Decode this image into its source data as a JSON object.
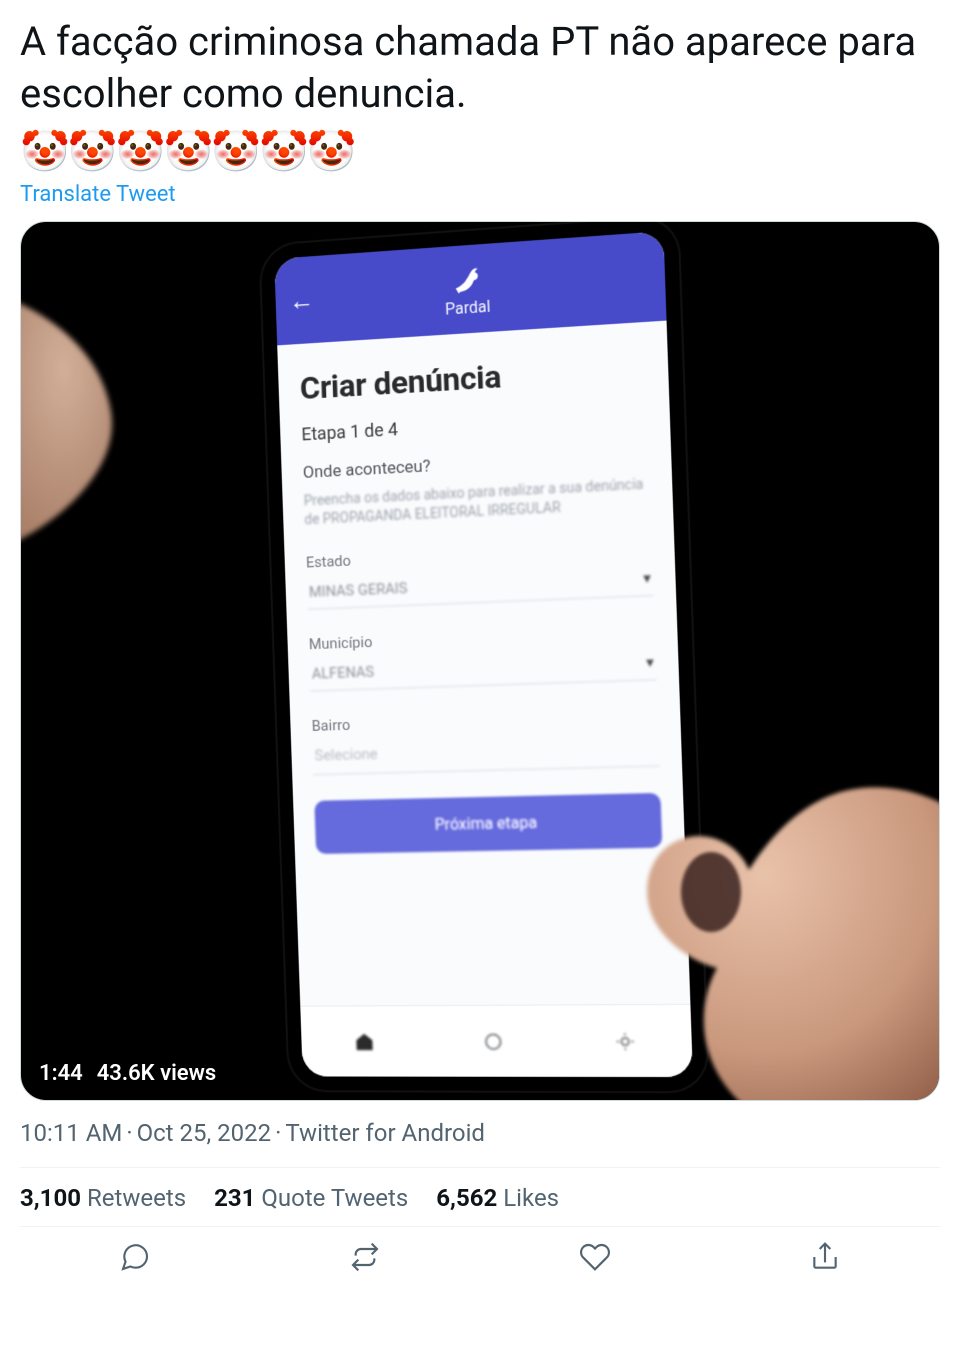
{
  "tweet": {
    "text": "A facção criminosa chamada PT não aparece para escolher como denuncia.",
    "emoji": "🤡",
    "emoji_count": 7,
    "translate_label": "Translate Tweet"
  },
  "video": {
    "duration": "1:44",
    "views": "43.6K views"
  },
  "app": {
    "name": "Pardal",
    "back_icon": "←",
    "title": "Criar denúncia",
    "step": "Etapa 1 de 4",
    "question": "Onde aconteceu?",
    "hint": "Preencha os dados abaixo para realizar a sua denúncia de PROPAGANDA ELEITORAL IRREGULAR",
    "fields": {
      "estado": {
        "label": "Estado",
        "value": "MINAS GERAIS"
      },
      "municipio": {
        "label": "Município",
        "value": "ALFENAS"
      },
      "bairro": {
        "label": "Bairro",
        "placeholder": "Selecione"
      }
    },
    "primary": "Próxima etapa"
  },
  "meta": {
    "time": "10:11 AM",
    "date": "Oct 25, 2022",
    "source": "Twitter for Android"
  },
  "stats": {
    "retweets_count": "3,100",
    "retweets_label": "Retweets",
    "quotes_count": "231",
    "quotes_label": "Quote Tweets",
    "likes_count": "6,562",
    "likes_label": "Likes"
  }
}
